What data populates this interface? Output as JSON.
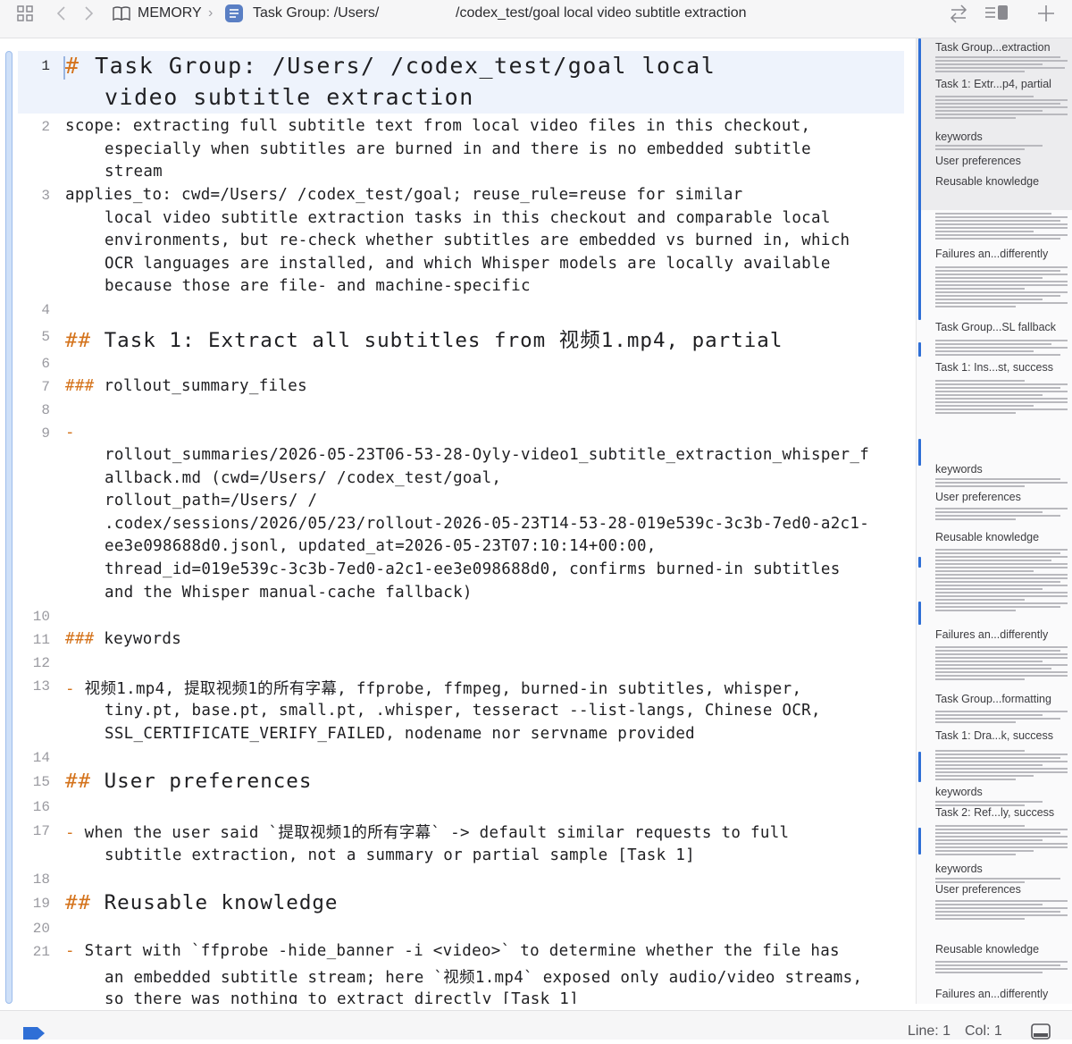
{
  "toolbar": {
    "grid_icon": "grid-icon",
    "back_icon": "chevron-left-icon",
    "forward_icon": "chevron-right-icon",
    "breadcrumb_root": "MEMORY",
    "breadcrumb_file": "Task Group: /Users/",
    "breadcrumb_file_suffix": "/codex_test/goal local video subtitle extraction",
    "swap_icon": "swap-arrows-icon",
    "list_icon": "list-layout-icon",
    "add_icon": "plus-icon"
  },
  "editor": {
    "lines": [
      {
        "n": "1",
        "kind": "h1",
        "marker": "#",
        "text": " Task Group: /Users/          /codex_test/goal local",
        "cont": [
          "video subtitle extraction"
        ]
      },
      {
        "n": "2",
        "kind": "text",
        "text": "scope: extracting full subtitle text from local video files in this checkout,",
        "cont": [
          "especially when subtitles are burned in and there is no embedded subtitle",
          "stream"
        ]
      },
      {
        "n": "3",
        "kind": "text",
        "text": "applies_to: cwd=/Users/         /codex_test/goal; reuse_rule=reuse for similar",
        "cont": [
          "local video subtitle extraction tasks in this checkout and comparable local",
          "environments, but re-check whether subtitles are embedded vs burned in, which",
          "OCR languages are installed, and which Whisper models are locally available",
          "because those are file- and machine-specific"
        ]
      },
      {
        "n": "4",
        "kind": "blank"
      },
      {
        "n": "5",
        "kind": "h2",
        "marker": "##",
        "text": " Task 1: Extract all subtitles from 视频1.mp4, partial"
      },
      {
        "n": "6",
        "kind": "blank"
      },
      {
        "n": "7",
        "kind": "h3",
        "marker": "###",
        "text": " rollout_summary_files"
      },
      {
        "n": "8",
        "kind": "blank"
      },
      {
        "n": "9",
        "kind": "bullet",
        "marker": "-",
        "text": "",
        "cont": [
          "rollout_summaries/2026-05-23T06-53-28-Oyly-video1_subtitle_extraction_whisper_f",
          "allback.md (cwd=/Users/         /codex_test/goal,",
          "rollout_path=/Users/         /",
          ".codex/sessions/2026/05/23/rollout-2026-05-23T14-53-28-019e539c-3c3b-7ed0-a2c1-",
          "ee3e098688d0.jsonl, updated_at=2026-05-23T07:10:14+00:00,",
          "thread_id=019e539c-3c3b-7ed0-a2c1-ee3e098688d0, confirms burned-in subtitles",
          "and the Whisper manual-cache fallback)"
        ]
      },
      {
        "n": "10",
        "kind": "blank"
      },
      {
        "n": "11",
        "kind": "h3",
        "marker": "###",
        "text": " keywords"
      },
      {
        "n": "12",
        "kind": "blank"
      },
      {
        "n": "13",
        "kind": "bullet",
        "marker": "-",
        "text": " 视频1.mp4, 提取视频1的所有字幕, ffprobe, ffmpeg, burned-in subtitles, whisper,",
        "cont": [
          "tiny.pt, base.pt, small.pt, .whisper, tesseract --list-langs, Chinese OCR,",
          "SSL_CERTIFICATE_VERIFY_FAILED, nodename nor servname provided"
        ]
      },
      {
        "n": "14",
        "kind": "blank"
      },
      {
        "n": "15",
        "kind": "h2",
        "marker": "##",
        "text": " User preferences"
      },
      {
        "n": "16",
        "kind": "blank"
      },
      {
        "n": "17",
        "kind": "bullet",
        "marker": "-",
        "text": " when the user said `提取视频1的所有字幕` -> default similar requests to full",
        "cont": [
          "subtitle extraction, not a summary or partial sample [Task 1]"
        ]
      },
      {
        "n": "18",
        "kind": "blank"
      },
      {
        "n": "19",
        "kind": "h2",
        "marker": "##",
        "text": " Reusable knowledge"
      },
      {
        "n": "20",
        "kind": "blank"
      },
      {
        "n": "21",
        "kind": "bullet",
        "marker": "-",
        "text": " Start with `ffprobe -hide_banner -i <video>` to determine whether the file has",
        "cont": [
          "an embedded subtitle stream; here `视频1.mp4` exposed only audio/video streams,",
          "so there was nothing to extract directly [Task 1]"
        ]
      }
    ]
  },
  "minimap": {
    "labels": [
      "Task Group...extraction",
      "Task 1: Extr...p4, partial",
      "keywords",
      "User preferences",
      "Reusable knowledge",
      "Failures an...differently",
      "Task Group...SL fallback",
      "Task 1: Ins...st, success",
      "keywords",
      "User preferences",
      "Reusable knowledge",
      "Failures an...differently",
      "Task Group...formatting",
      "Task 1: Dra...k, success",
      "keywords",
      "Task 2: Ref...ly, success",
      "keywords",
      "User preferences",
      "Reusable knowledge",
      "Failures an...differently"
    ]
  },
  "status": {
    "line": "Line: 1",
    "col": "Col: 1",
    "tag_icon": "tag-icon",
    "panel_icon": "panel-toggle-icon",
    "accent": "#2f6fd6"
  }
}
